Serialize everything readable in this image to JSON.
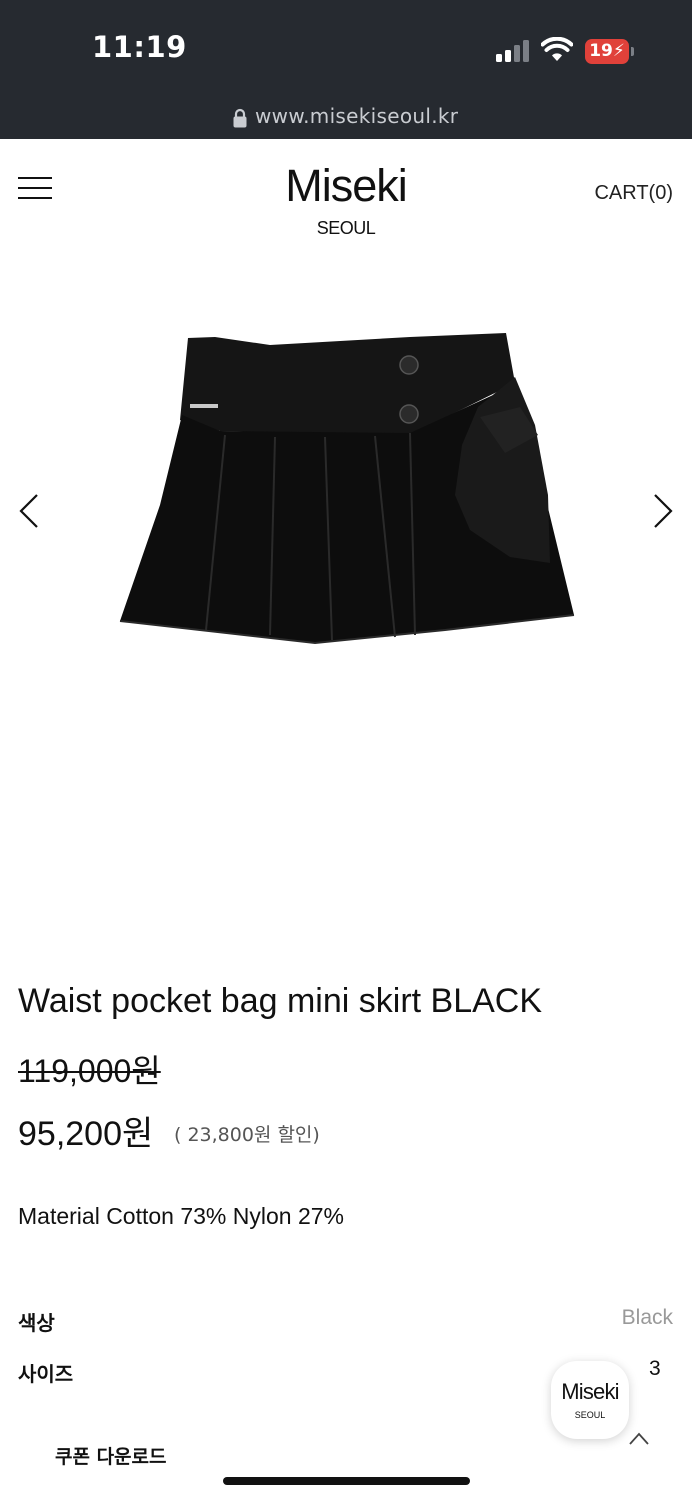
{
  "status_bar": {
    "time": "11:19",
    "battery": "19"
  },
  "browser": {
    "url": "www.misekiseoul.kr"
  },
  "header": {
    "logo_title": "Miseki",
    "logo_sub": "SEOUL",
    "cart_label": "CART(0)"
  },
  "product": {
    "title": "Waist pocket bag mini skirt BLACK",
    "original_price": "119,000원",
    "sale_price": "95,200원",
    "discount_text": "( 23,800원 할인)",
    "material": "Material Cotton 73% Nylon 27%",
    "image_icon": "skirt-photo",
    "colors": {
      "accent": "#111111",
      "status_bar_bg": "#262a30",
      "battery": "#e0413a"
    }
  },
  "options": {
    "color_label": "색상",
    "color_value": "Black",
    "size_label": "사이즈",
    "size_value": "3"
  },
  "coupon": {
    "label": "쿠폰 다운로드"
  },
  "floating": {
    "logo_title": "Miseki",
    "logo_sub": "SEOUL"
  }
}
